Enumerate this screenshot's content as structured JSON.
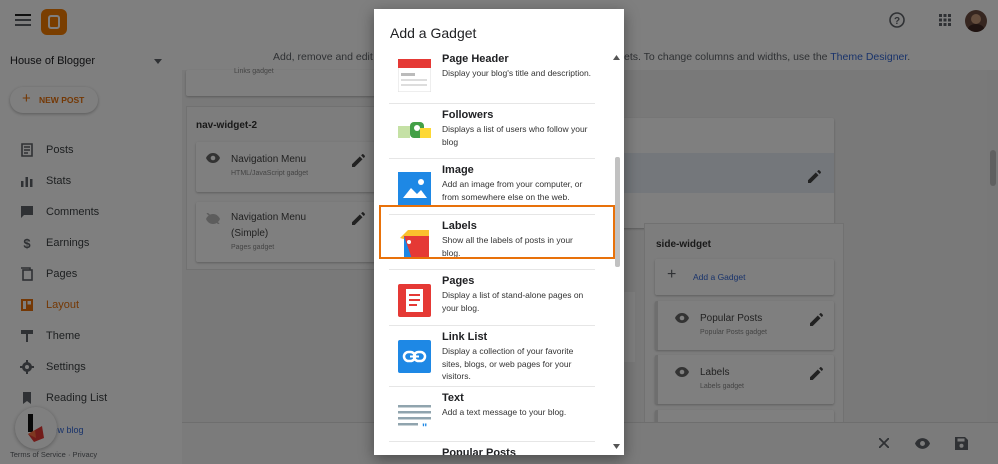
{
  "app": {
    "blog_name": "House of Blogger",
    "new_post_label": "NEW POST"
  },
  "nav": [
    {
      "label": "Posts",
      "icon": "posts-icon"
    },
    {
      "label": "Stats",
      "icon": "stats-icon"
    },
    {
      "label": "Comments",
      "icon": "comments-icon"
    },
    {
      "label": "Earnings",
      "icon": "earnings-icon"
    },
    {
      "label": "Pages",
      "icon": "pages-icon"
    },
    {
      "label": "Layout",
      "icon": "layout-icon",
      "active": true
    },
    {
      "label": "Theme",
      "icon": "theme-icon"
    },
    {
      "label": "Settings",
      "icon": "settings-icon"
    },
    {
      "label": "Reading List",
      "icon": "bookmark-icon"
    }
  ],
  "sidebar_footer": {
    "new_blog": "New blog",
    "terms": "Terms of Service",
    "privacy": "Privacy"
  },
  "info": {
    "left": "Add, remove and edit",
    "right": "ets. To change columns and widths, use the",
    "link": "Theme Designer",
    "end": "."
  },
  "layout": {
    "top_gadget_sub": "Links gadget",
    "nav_widget": {
      "title": "nav-widget-2",
      "gadgets": [
        {
          "name": "Navigation Menu",
          "sub": "HTML/JavaScript gadget"
        },
        {
          "name": "Navigation Menu",
          "name2": "(Simple)",
          "sub": "Pages gadget"
        }
      ]
    },
    "side_widget": {
      "title": "side-widget",
      "add_label": "Add a Gadget",
      "gadgets": [
        {
          "name": "Popular Posts",
          "sub": "Popular Posts gadget"
        },
        {
          "name": "Labels",
          "sub": "Labels gadget"
        }
      ]
    }
  },
  "dialog": {
    "title": "Add a Gadget",
    "items": [
      {
        "title": "Page Header",
        "desc": "Display your blog's title and description."
      },
      {
        "title": "Followers",
        "desc": "Displays a list of users who follow your blog"
      },
      {
        "title": "Image",
        "desc": "Add an image from your computer, or from somewhere else on the web.",
        "highlighted": true
      },
      {
        "title": "Labels",
        "desc": "Show all the labels of posts in your blog."
      },
      {
        "title": "Pages",
        "desc": "Display a list of stand-alone pages on your blog."
      },
      {
        "title": "Link List",
        "desc": "Display a collection of your favorite sites, blogs, or web pages for your visitors."
      },
      {
        "title": "Text",
        "desc": "Add a text message to your blog."
      },
      {
        "title": "Popular Posts",
        "desc": ""
      }
    ]
  },
  "colors": {
    "accent": "#e8710a",
    "link": "#3367d6",
    "overlay": "rgba(0,0,0,0.5)"
  }
}
